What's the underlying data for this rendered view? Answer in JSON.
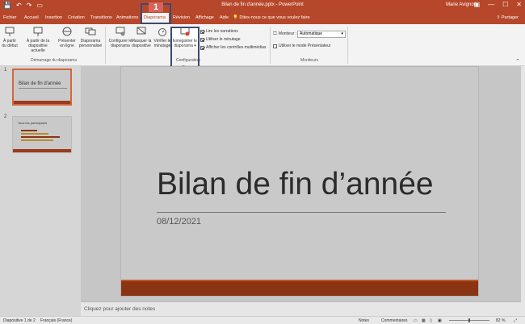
{
  "titlebar": {
    "doc_title": "Bilan de fin d'année.pptx  -  PowerPoint",
    "user": "Marie Avignon",
    "qat": [
      "save-icon",
      "undo-icon",
      "redo-icon",
      "start-from-beginning-icon"
    ]
  },
  "tabs": [
    "Fichier",
    "Accueil",
    "Insertion",
    "Création",
    "Transitions",
    "Animations",
    "Diaporama",
    "Révision",
    "Affichage",
    "Aide"
  ],
  "active_tab": "Diaporama",
  "tellme": "Dites-nous ce que vous voulez faire",
  "share": "Partager",
  "ribbon": {
    "group_start": {
      "label": "Démarrage du diaporama",
      "buttons": [
        "À partir du début",
        "À partir de la diapositive actuelle",
        "Présenter en ligne",
        "Diaporama personnalisé"
      ]
    },
    "group_config": {
      "label": "Configuration",
      "buttons": [
        "Configurer le diaporama",
        "Masquer la diapositive",
        "Vérifier le minutage",
        "Enregistrer le diaporama"
      ],
      "checks": [
        {
          "label": "Lire les narrations",
          "checked": true
        },
        {
          "label": "Utiliser le minutage",
          "checked": true
        },
        {
          "label": "Afficher les contrôles multimédias",
          "checked": true
        }
      ]
    },
    "group_monitors": {
      "label": "Moniteurs",
      "monitor_label": "Moniteur :",
      "monitor_value": "Automatique",
      "presenter_check": "Utiliser le mode Présentateur"
    }
  },
  "annotations": {
    "badge1": "1",
    "badge2": "2"
  },
  "slides": [
    {
      "num": "1",
      "title": "Bilan de fin d'année"
    },
    {
      "num": "2",
      "title": "Tous les participants"
    }
  ],
  "current_slide": {
    "title": "Bilan de fin d’année",
    "date": "08/12/2021"
  },
  "notes_placeholder": "Cliquez pour ajouter des notes",
  "status": {
    "slide_count": "Diapositive 1 de 2",
    "language": "Français (France)",
    "notes": "Notes",
    "comments": "Commentaires",
    "zoom": "82 %"
  },
  "colors": {
    "accent": "#b7472a",
    "slide_footer": "#8a3414",
    "highlight": "#3b4a73"
  }
}
